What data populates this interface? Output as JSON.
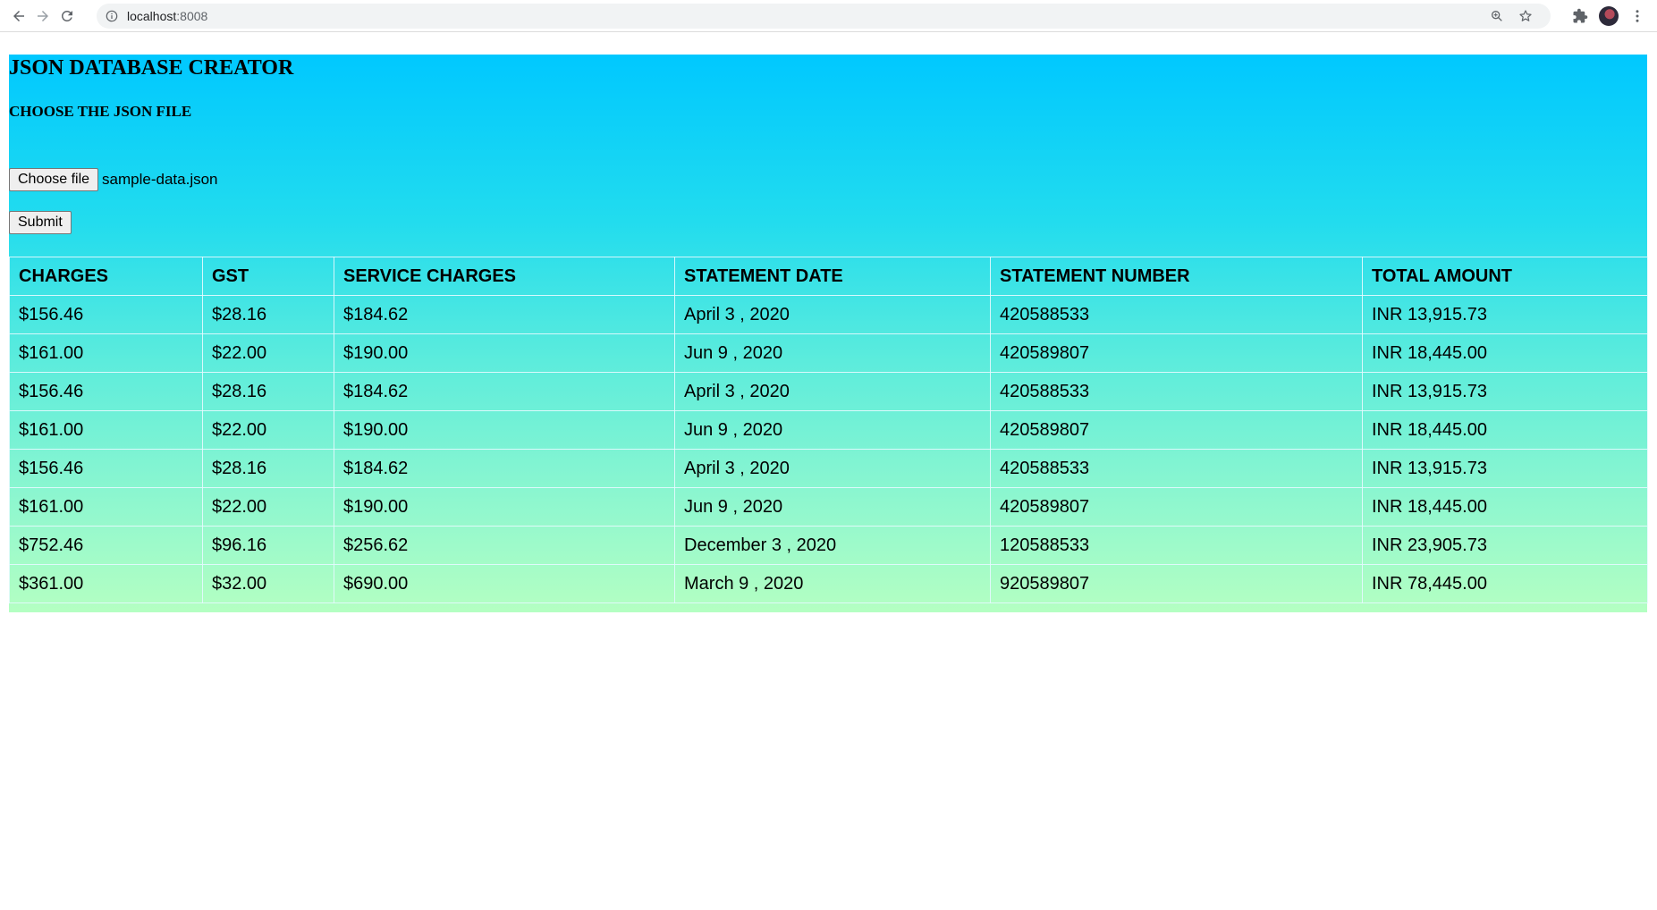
{
  "browser": {
    "url_host": "localhost",
    "url_port": ":8008"
  },
  "page": {
    "title": "JSON DATABASE CREATOR",
    "subtitle": "CHOOSE THE JSON FILE",
    "choose_file_label": "Choose file",
    "file_name": "sample-data.json",
    "submit_label": "Submit"
  },
  "table": {
    "headers": [
      "CHARGES",
      "GST",
      "SERVICE CHARGES",
      "STATEMENT DATE",
      "STATEMENT NUMBER",
      "TOTAL AMOUNT"
    ],
    "rows": [
      [
        "$156.46",
        "$28.16",
        "$184.62",
        "April 3 , 2020",
        "420588533",
        "INR 13,915.73"
      ],
      [
        "$161.00",
        "$22.00",
        "$190.00",
        "Jun 9 , 2020",
        "420589807",
        "INR 18,445.00"
      ],
      [
        "$156.46",
        "$28.16",
        "$184.62",
        "April 3 , 2020",
        "420588533",
        "INR 13,915.73"
      ],
      [
        "$161.00",
        "$22.00",
        "$190.00",
        "Jun 9 , 2020",
        "420589807",
        "INR 18,445.00"
      ],
      [
        "$156.46",
        "$28.16",
        "$184.62",
        "April 3 , 2020",
        "420588533",
        "INR 13,915.73"
      ],
      [
        "$161.00",
        "$22.00",
        "$190.00",
        "Jun 9 , 2020",
        "420589807",
        "INR 18,445.00"
      ],
      [
        "$752.46",
        "$96.16",
        "$256.62",
        "December 3 , 2020",
        "120588533",
        "INR 23,905.73"
      ],
      [
        "$361.00",
        "$32.00",
        "$690.00",
        "March 9 , 2020",
        "920589807",
        "INR 78,445.00"
      ]
    ]
  },
  "colors": {
    "gradient_top": "#00c8ff",
    "gradient_bottom": "#b4ffc2"
  },
  "icons": {
    "back": "arrow-left-icon",
    "forward": "arrow-right-icon",
    "reload": "reload-icon",
    "info": "info-icon",
    "zoom": "zoom-icon",
    "bookmark": "star-icon",
    "extensions": "puzzle-icon",
    "menu": "kebab-menu-icon"
  }
}
